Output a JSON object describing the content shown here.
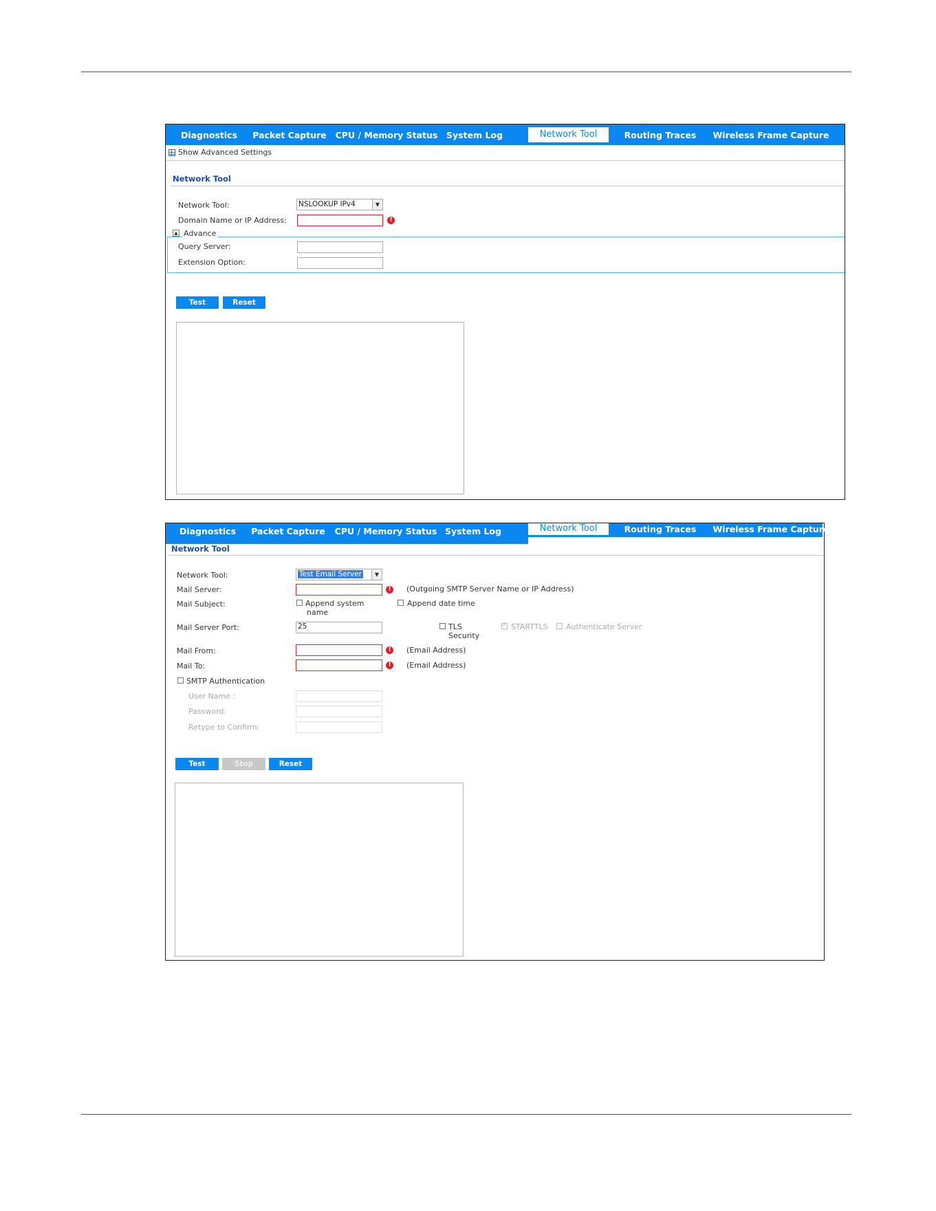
{
  "tabs": [
    "Diagnostics",
    "Packet Capture",
    "CPU / Memory Status",
    "System Log",
    "Network Tool",
    "Routing Traces",
    "Wireless Frame Capture"
  ],
  "shot1": {
    "show_advanced": "Show Advanced Settings",
    "section_title": "Network Tool",
    "network_tool_label": "Network Tool:",
    "network_tool_value": "NSLOOKUP IPv4",
    "domain_label": "Domain Name or IP Address:",
    "advance_legend": "Advance",
    "query_server_label": "Query Server:",
    "extension_option_label": "Extension Option:",
    "test_button": "Test",
    "reset_button": "Reset"
  },
  "shot2": {
    "section_title": "Network Tool",
    "network_tool_label": "Network Tool:",
    "network_tool_value": "Test Email Server",
    "mail_server_label": "Mail Server:",
    "mail_server_hint": "(Outgoing SMTP Server Name or IP Address)",
    "mail_subject_label": "Mail Subject:",
    "append_system_name_line1": "Append system",
    "append_system_name_line2": "name",
    "append_date_time": "Append date time",
    "mail_server_port_label": "Mail Server Port:",
    "mail_server_port_value": "25",
    "tls_line1": "TLS",
    "tls_line2": "Security",
    "starttls": "STARTTLS",
    "authenticate_server": "Authenticate Server",
    "mail_from_label": "Mail From:",
    "mail_from_hint": "(Email Address)",
    "mail_to_label": "Mail To:",
    "mail_to_hint": "(Email Address)",
    "smtp_auth_label": "SMTP Authentication",
    "user_name_label": "User Name :",
    "password_label": "Password:",
    "retype_label": "Retype to Confirm:",
    "test_button": "Test",
    "stop_button": "Stop",
    "reset_button": "Reset"
  },
  "colors": {
    "tab_bar": "#0a87f0",
    "section_title": "#1c4e96",
    "error": "#e01d2a",
    "advance_border": "#5bb8e6"
  }
}
